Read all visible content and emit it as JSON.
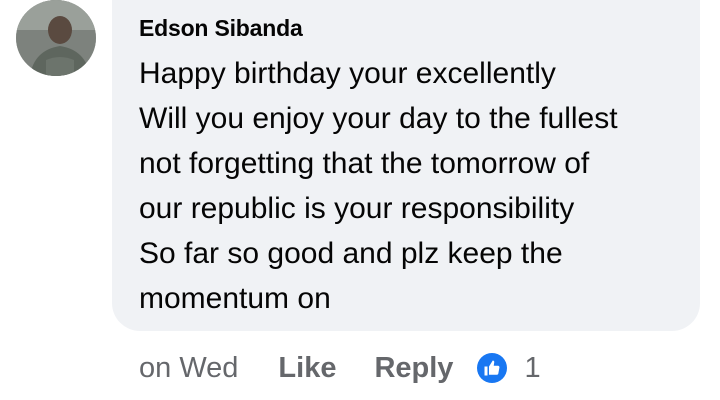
{
  "comment": {
    "author": "Edson Sibanda",
    "lines": [
      "Happy birthday your excellently",
      "Will you enjoy your day to the fullest",
      "not forgetting that the tomorrow of",
      "our republic is your responsibility",
      "So far so good and plz keep the",
      "momentum on"
    ],
    "avatar_icon": "user-avatar",
    "bubble_color": "#f0f2f5"
  },
  "actions": {
    "time": "on Wed",
    "like_label": "Like",
    "reply_label": "Reply",
    "reaction_icon": "thumbs-up-icon",
    "reaction_color": "#1877f2",
    "reaction_count": "1"
  }
}
